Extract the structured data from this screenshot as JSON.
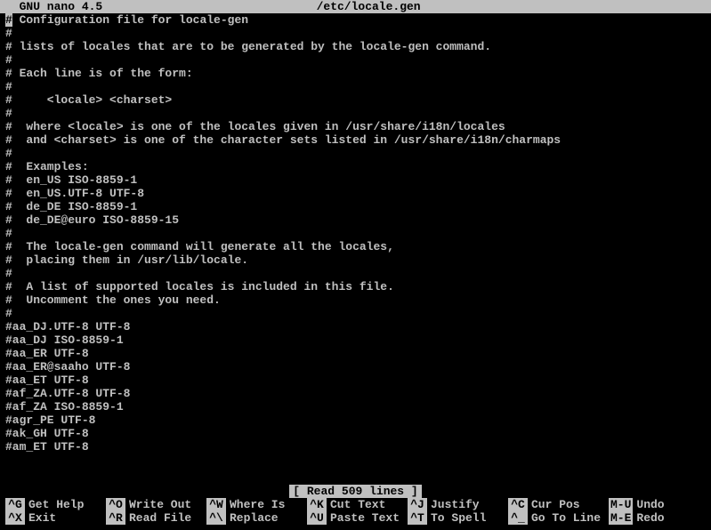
{
  "titlebar": {
    "left": "  GNU nano 4.5",
    "center": "/etc/locale.gen"
  },
  "editor": {
    "lines": [
      {
        "text": "#",
        "cursor": true,
        "after": " Configuration file for locale-gen"
      },
      {
        "text": "#"
      },
      {
        "text": "# lists of locales that are to be generated by the locale-gen command."
      },
      {
        "text": "#"
      },
      {
        "text": "# Each line is of the form:"
      },
      {
        "text": "#"
      },
      {
        "text": "#     <locale> <charset>"
      },
      {
        "text": "#"
      },
      {
        "text": "#  where <locale> is one of the locales given in /usr/share/i18n/locales"
      },
      {
        "text": "#  and <charset> is one of the character sets listed in /usr/share/i18n/charmaps"
      },
      {
        "text": "#"
      },
      {
        "text": "#  Examples:"
      },
      {
        "text": "#  en_US ISO-8859-1"
      },
      {
        "text": "#  en_US.UTF-8 UTF-8"
      },
      {
        "text": "#  de_DE ISO-8859-1"
      },
      {
        "text": "#  de_DE@euro ISO-8859-15"
      },
      {
        "text": "#"
      },
      {
        "text": "#  The locale-gen command will generate all the locales,"
      },
      {
        "text": "#  placing them in /usr/lib/locale."
      },
      {
        "text": "#"
      },
      {
        "text": "#  A list of supported locales is included in this file."
      },
      {
        "text": "#  Uncomment the ones you need."
      },
      {
        "text": "#"
      },
      {
        "text": "#aa_DJ.UTF-8 UTF-8"
      },
      {
        "text": "#aa_DJ ISO-8859-1"
      },
      {
        "text": "#aa_ER UTF-8"
      },
      {
        "text": "#aa_ER@saaho UTF-8"
      },
      {
        "text": "#aa_ET UTF-8"
      },
      {
        "text": "#af_ZA.UTF-8 UTF-8"
      },
      {
        "text": "#af_ZA ISO-8859-1"
      },
      {
        "text": "#agr_PE UTF-8"
      },
      {
        "text": "#ak_GH UTF-8"
      },
      {
        "text": "#am_ET UTF-8"
      }
    ]
  },
  "status": "[ Read 509 lines ]",
  "shortcuts": [
    {
      "key": "^G",
      "label": "Get Help"
    },
    {
      "key": "^O",
      "label": "Write Out"
    },
    {
      "key": "^W",
      "label": "Where Is"
    },
    {
      "key": "^K",
      "label": "Cut Text"
    },
    {
      "key": "^J",
      "label": "Justify"
    },
    {
      "key": "^C",
      "label": "Cur Pos"
    },
    {
      "key": "M-U",
      "label": "Undo"
    },
    {
      "key": "^X",
      "label": "Exit"
    },
    {
      "key": "^R",
      "label": "Read File"
    },
    {
      "key": "^\\",
      "label": "Replace"
    },
    {
      "key": "^U",
      "label": "Paste Text"
    },
    {
      "key": "^T",
      "label": "To Spell"
    },
    {
      "key": "^_",
      "label": "Go To Line"
    },
    {
      "key": "M-E",
      "label": "Redo"
    }
  ]
}
